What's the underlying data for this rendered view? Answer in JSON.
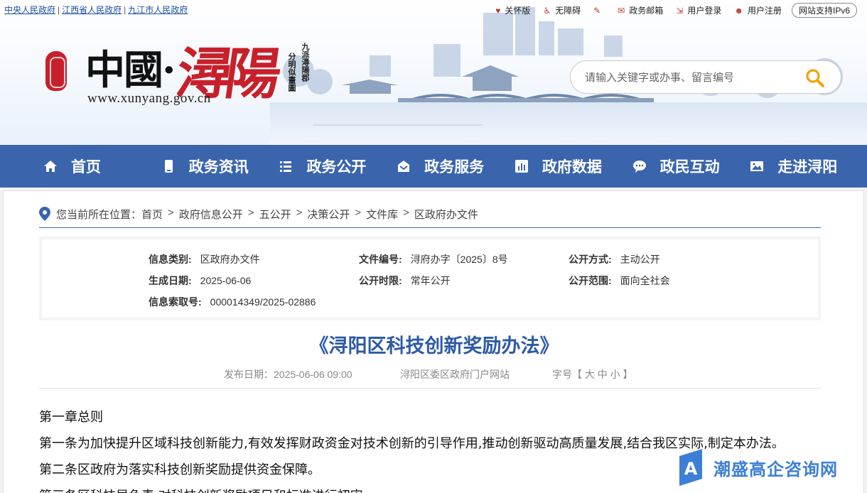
{
  "top_links": [
    "中央人民政府",
    "江西省人民政府",
    "九江市人民政府"
  ],
  "toolbar": {
    "care": "关怀版",
    "accessible": "无障碍",
    "mailbox": "政务邮箱",
    "login": "用户登录",
    "register": "用户注册",
    "ipv6": "网站支持IPv6"
  },
  "logo": {
    "cn": "中國·",
    "red": "潯陽",
    "url": "www.xunyang.gov.cn",
    "motto_a": "九派潯陽郡",
    "motto_b": "分明似畫圖"
  },
  "search": {
    "placeholder": "请输入关键字或办事、留言编号"
  },
  "nav": [
    {
      "label": "首页",
      "icon": "home-icon"
    },
    {
      "label": "政务资讯",
      "icon": "phone-icon"
    },
    {
      "label": "政务公开",
      "icon": "list-icon"
    },
    {
      "label": "政务服务",
      "icon": "inbox-icon"
    },
    {
      "label": "政府数据",
      "icon": "chart-icon"
    },
    {
      "label": "政民互动",
      "icon": "chat-icon"
    },
    {
      "label": "走进浔阳",
      "icon": "image-icon"
    }
  ],
  "breadcrumb": {
    "label": "您当前所在位置：",
    "items": [
      "首页",
      "政府信息公开",
      "五公开",
      "决策公开",
      "文件库",
      "区政府办文件"
    ]
  },
  "meta": {
    "category_label": "信息类别:",
    "category": "区政府办文件",
    "docno_label": "文件编号:",
    "docno": "浔府办字〔2025〕8号",
    "mode_label": "公开方式:",
    "mode": "主动公开",
    "date_label": "生成日期:",
    "date": "2025-06-06",
    "period_label": "公开时限:",
    "period": "常年公开",
    "scope_label": "公开范围:",
    "scope": "面向全社会",
    "index_label": "信息索取号:",
    "index": "000014349/2025-02886"
  },
  "article": {
    "title": "《浔阳区科技创新奖励办法》",
    "pubdate": "发布日期：2025-06-06 09:00",
    "source": "浔阳区委区政府门户网站",
    "fontsize": "字号【 大  中  小 】",
    "paragraphs": [
      "第一章总则",
      "第一条为加快提升区域科技创新能力,有效发挥财政资金对技术创新的引导作用,推动创新驱动高质量发展,结合我区实际,制定本办法。",
      "第二条区政府为落实科技创新奖励提供资金保障。",
      "第三条区科技局负责,对科技创新奖励项目和标准进行初审"
    ]
  },
  "watermark": {
    "text": "潮盛高企咨询网"
  },
  "colors": {
    "nav_bg": "#3a65ad",
    "title": "#2d5aa6",
    "seal": "#c8202a"
  }
}
